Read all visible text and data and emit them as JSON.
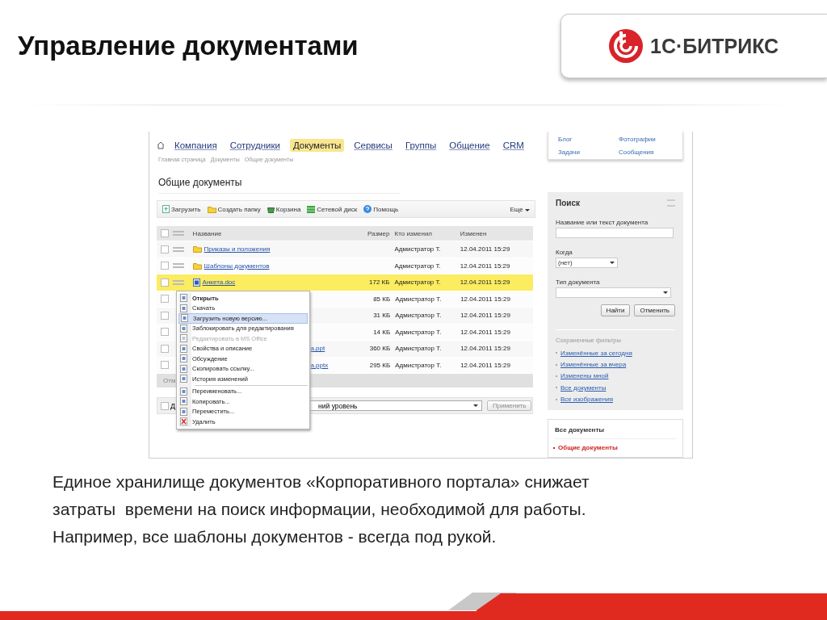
{
  "slide": {
    "title": "Управление документами",
    "logo_text": "1С·БИТРИКС"
  },
  "screenshot": {
    "nav": [
      {
        "label": "Компания",
        "selected": false
      },
      {
        "label": "Сотрудники",
        "selected": false
      },
      {
        "label": "Документы",
        "selected": true
      },
      {
        "label": "Сервисы",
        "selected": false
      },
      {
        "label": "Группы",
        "selected": false
      },
      {
        "label": "Общение",
        "selected": false
      },
      {
        "label": "CRM",
        "selected": false
      }
    ],
    "breadcrumbs": [
      "Главная страница",
      "Документы",
      "Общие документы"
    ],
    "page_title": "Общие документы",
    "toolbar": [
      {
        "kind": "upload",
        "label": "Загрузить"
      },
      {
        "kind": "folder",
        "label": "Создать папку"
      },
      {
        "kind": "basket",
        "label": "Корзина"
      },
      {
        "kind": "disk",
        "label": "Сетевой диск"
      },
      {
        "kind": "help",
        "label": "Помощь"
      }
    ],
    "toolbar_more": "Еще",
    "table": {
      "header_checked": false,
      "columns": [
        "Название",
        "Размер",
        "Кто изменил",
        "Изменен"
      ],
      "rows": [
        {
          "kind": "folder",
          "checked": false,
          "selected": false,
          "name": "Приказы и положения",
          "size": "",
          "author": "Адмистратор Т.",
          "date": "12.04.2011 15:29"
        },
        {
          "kind": "folder",
          "checked": false,
          "selected": false,
          "name": "Шаблоны документов",
          "size": "",
          "author": "Адмистратор Т.",
          "date": "12.04.2011 15:29"
        },
        {
          "kind": "file",
          "checked": false,
          "selected": true,
          "name": "Анкета.doc",
          "size": "172 КБ",
          "author": "Адмистратор Т.",
          "date": "12.04.2011 15:29"
        },
        {
          "kind": "covered",
          "checked": false,
          "selected": false,
          "name": "",
          "size": "85 КБ",
          "author": "Адмистратор Т.",
          "date": "12.04.2011 15:29"
        },
        {
          "kind": "covered",
          "checked": false,
          "selected": false,
          "name": "",
          "size": "31 КБ",
          "author": "Адмистратор Т.",
          "date": "12.04.2011 15:29"
        },
        {
          "kind": "covered",
          "checked": false,
          "selected": false,
          "name": "",
          "size": "14 КБ",
          "author": "Адмистратор Т.",
          "date": "12.04.2011 15:29"
        },
        {
          "kind": "covered",
          "checked": false,
          "selected": false,
          "name": "a.ppt",
          "size": "360 КБ",
          "author": "Адмистратор Т.",
          "date": "12.04.2011 15:29"
        },
        {
          "kind": "covered",
          "checked": false,
          "selected": false,
          "name": "a.pptx",
          "size": "295 КБ",
          "author": "Адмистратор Т.",
          "date": "12.04.2011 15:29"
        }
      ],
      "footer": "Отм"
    },
    "action_bar": {
      "checked": false,
      "label": "Д",
      "select_value": "ний уровень",
      "button": "Применить"
    },
    "context_menu": [
      {
        "label": "Открыть",
        "kind": "default",
        "selected": false,
        "disabled": false,
        "separator_before": false
      },
      {
        "label": "Скачать",
        "kind": "item",
        "selected": false,
        "disabled": false,
        "separator_before": false
      },
      {
        "label": "Загрузить новую версию...",
        "kind": "item",
        "selected": true,
        "disabled": false,
        "separator_before": false
      },
      {
        "label": "Заблокировать для редактирования",
        "kind": "item",
        "selected": false,
        "disabled": false,
        "separator_before": false
      },
      {
        "label": "Редактировать в MS Office",
        "kind": "item",
        "selected": false,
        "disabled": true,
        "separator_before": false
      },
      {
        "label": "Свойства и описание",
        "kind": "item",
        "selected": false,
        "disabled": false,
        "separator_before": false
      },
      {
        "label": "Обсуждение",
        "kind": "item",
        "selected": false,
        "disabled": false,
        "separator_before": false
      },
      {
        "label": "Скопировать ссылку...",
        "kind": "item",
        "selected": false,
        "disabled": false,
        "separator_before": false
      },
      {
        "label": "История изменений",
        "kind": "item",
        "selected": false,
        "disabled": false,
        "separator_before": false
      },
      {
        "label": "Переименовать...",
        "kind": "item",
        "selected": false,
        "disabled": false,
        "separator_before": true
      },
      {
        "label": "Копировать...",
        "kind": "item",
        "selected": false,
        "disabled": false,
        "separator_before": false
      },
      {
        "label": "Переместить...",
        "kind": "item",
        "selected": false,
        "disabled": false,
        "separator_before": false
      },
      {
        "label": "Удалить",
        "kind": "delete",
        "selected": false,
        "disabled": false,
        "separator_before": false
      }
    ],
    "sidebar": {
      "top_links": [
        "Блог",
        "Фотографии",
        "Задачи",
        "Сообщения"
      ],
      "search": {
        "title": "Поиск",
        "fields": [
          {
            "kind": "text",
            "label": "Название или текст документа"
          },
          {
            "kind": "select",
            "label": "Когда",
            "value": "(нет)"
          },
          {
            "kind": "select_wide",
            "label": "Тип документа"
          }
        ],
        "buttons": [
          "Найти",
          "Отменить"
        ],
        "filters_title": "Сохраненные фильтры",
        "filters": [
          "Изменённые за сегодня",
          "Изменённые за вчера",
          "Изменены мной",
          "Все документы",
          "Все изображения"
        ]
      },
      "docs_box": {
        "title": "Все документы",
        "items": [
          {
            "label": "Общие документы",
            "selected": true
          }
        ]
      }
    }
  },
  "caption": [
    "Единое хранилище документов «Корпоративного портала» снижает",
    "затраты  времени на поиск информации, необходимой для работы.",
    "Например, все шаблоны документов - всегда под рукой."
  ]
}
